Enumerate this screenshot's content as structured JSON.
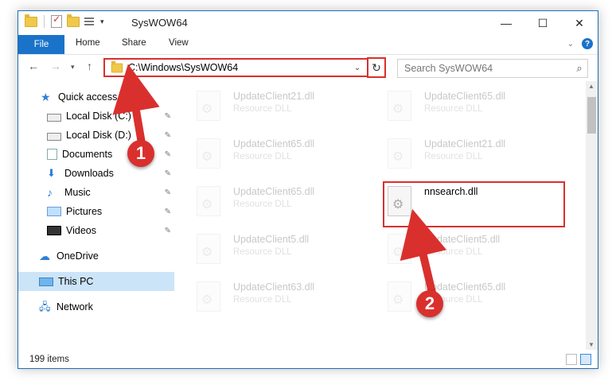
{
  "window": {
    "title": "SysWOW64"
  },
  "ribbon": {
    "tabs": [
      "File",
      "Home",
      "Share",
      "View"
    ]
  },
  "navigation": {
    "address": "C:\\Windows\\SysWOW64",
    "search_placeholder": "Search SysWOW64"
  },
  "sidebar": {
    "items": [
      {
        "label": "Quick access",
        "icon": "star-icon"
      },
      {
        "label": "Local Disk (C:)",
        "icon": "drive-icon",
        "pinned": true
      },
      {
        "label": "Local Disk (D:)",
        "icon": "drive-icon",
        "pinned": true
      },
      {
        "label": "Documents",
        "icon": "documents-icon",
        "pinned": true
      },
      {
        "label": "Downloads",
        "icon": "download-icon",
        "pinned": true
      },
      {
        "label": "Music",
        "icon": "music-icon",
        "pinned": true
      },
      {
        "label": "Pictures",
        "icon": "pictures-icon",
        "pinned": true
      },
      {
        "label": "Videos",
        "icon": "videos-icon",
        "pinned": true
      },
      {
        "label": "OneDrive",
        "icon": "cloud-icon"
      },
      {
        "label": "This PC",
        "icon": "computer-icon",
        "selected": true
      },
      {
        "label": "Network",
        "icon": "network-icon"
      }
    ]
  },
  "files": [
    {
      "name": "UpdateClient21.dll",
      "type": "Resource DLL",
      "faded": true
    },
    {
      "name": "UpdateClient65.dll",
      "type": "Resource DLL",
      "faded": true
    },
    {
      "name": "UpdateClient65.dll",
      "type": "Resource DLL",
      "faded": true
    },
    {
      "name": "UpdateClient21.dll",
      "type": "Resource DLL",
      "faded": true
    },
    {
      "name": "UpdateClient65.dll",
      "type": "Resource DLL",
      "faded": true
    },
    {
      "name": "nnsearch.dll",
      "type": "",
      "faded": false,
      "highlighted": true
    },
    {
      "name": "UpdateClient5.dll",
      "type": "Resource DLL",
      "faded": true
    },
    {
      "name": "UpdateClient5.dll",
      "type": "Resource DLL",
      "faded": true
    },
    {
      "name": "UpdateClient63.dll",
      "type": "Resource DLL",
      "faded": true
    },
    {
      "name": "UpdateClient65.dll",
      "type": "Resource DLL",
      "faded": true
    }
  ],
  "status": {
    "item_count": "199 items"
  },
  "annotations": {
    "step1": "1",
    "step2": "2",
    "color": "#d9302e"
  }
}
